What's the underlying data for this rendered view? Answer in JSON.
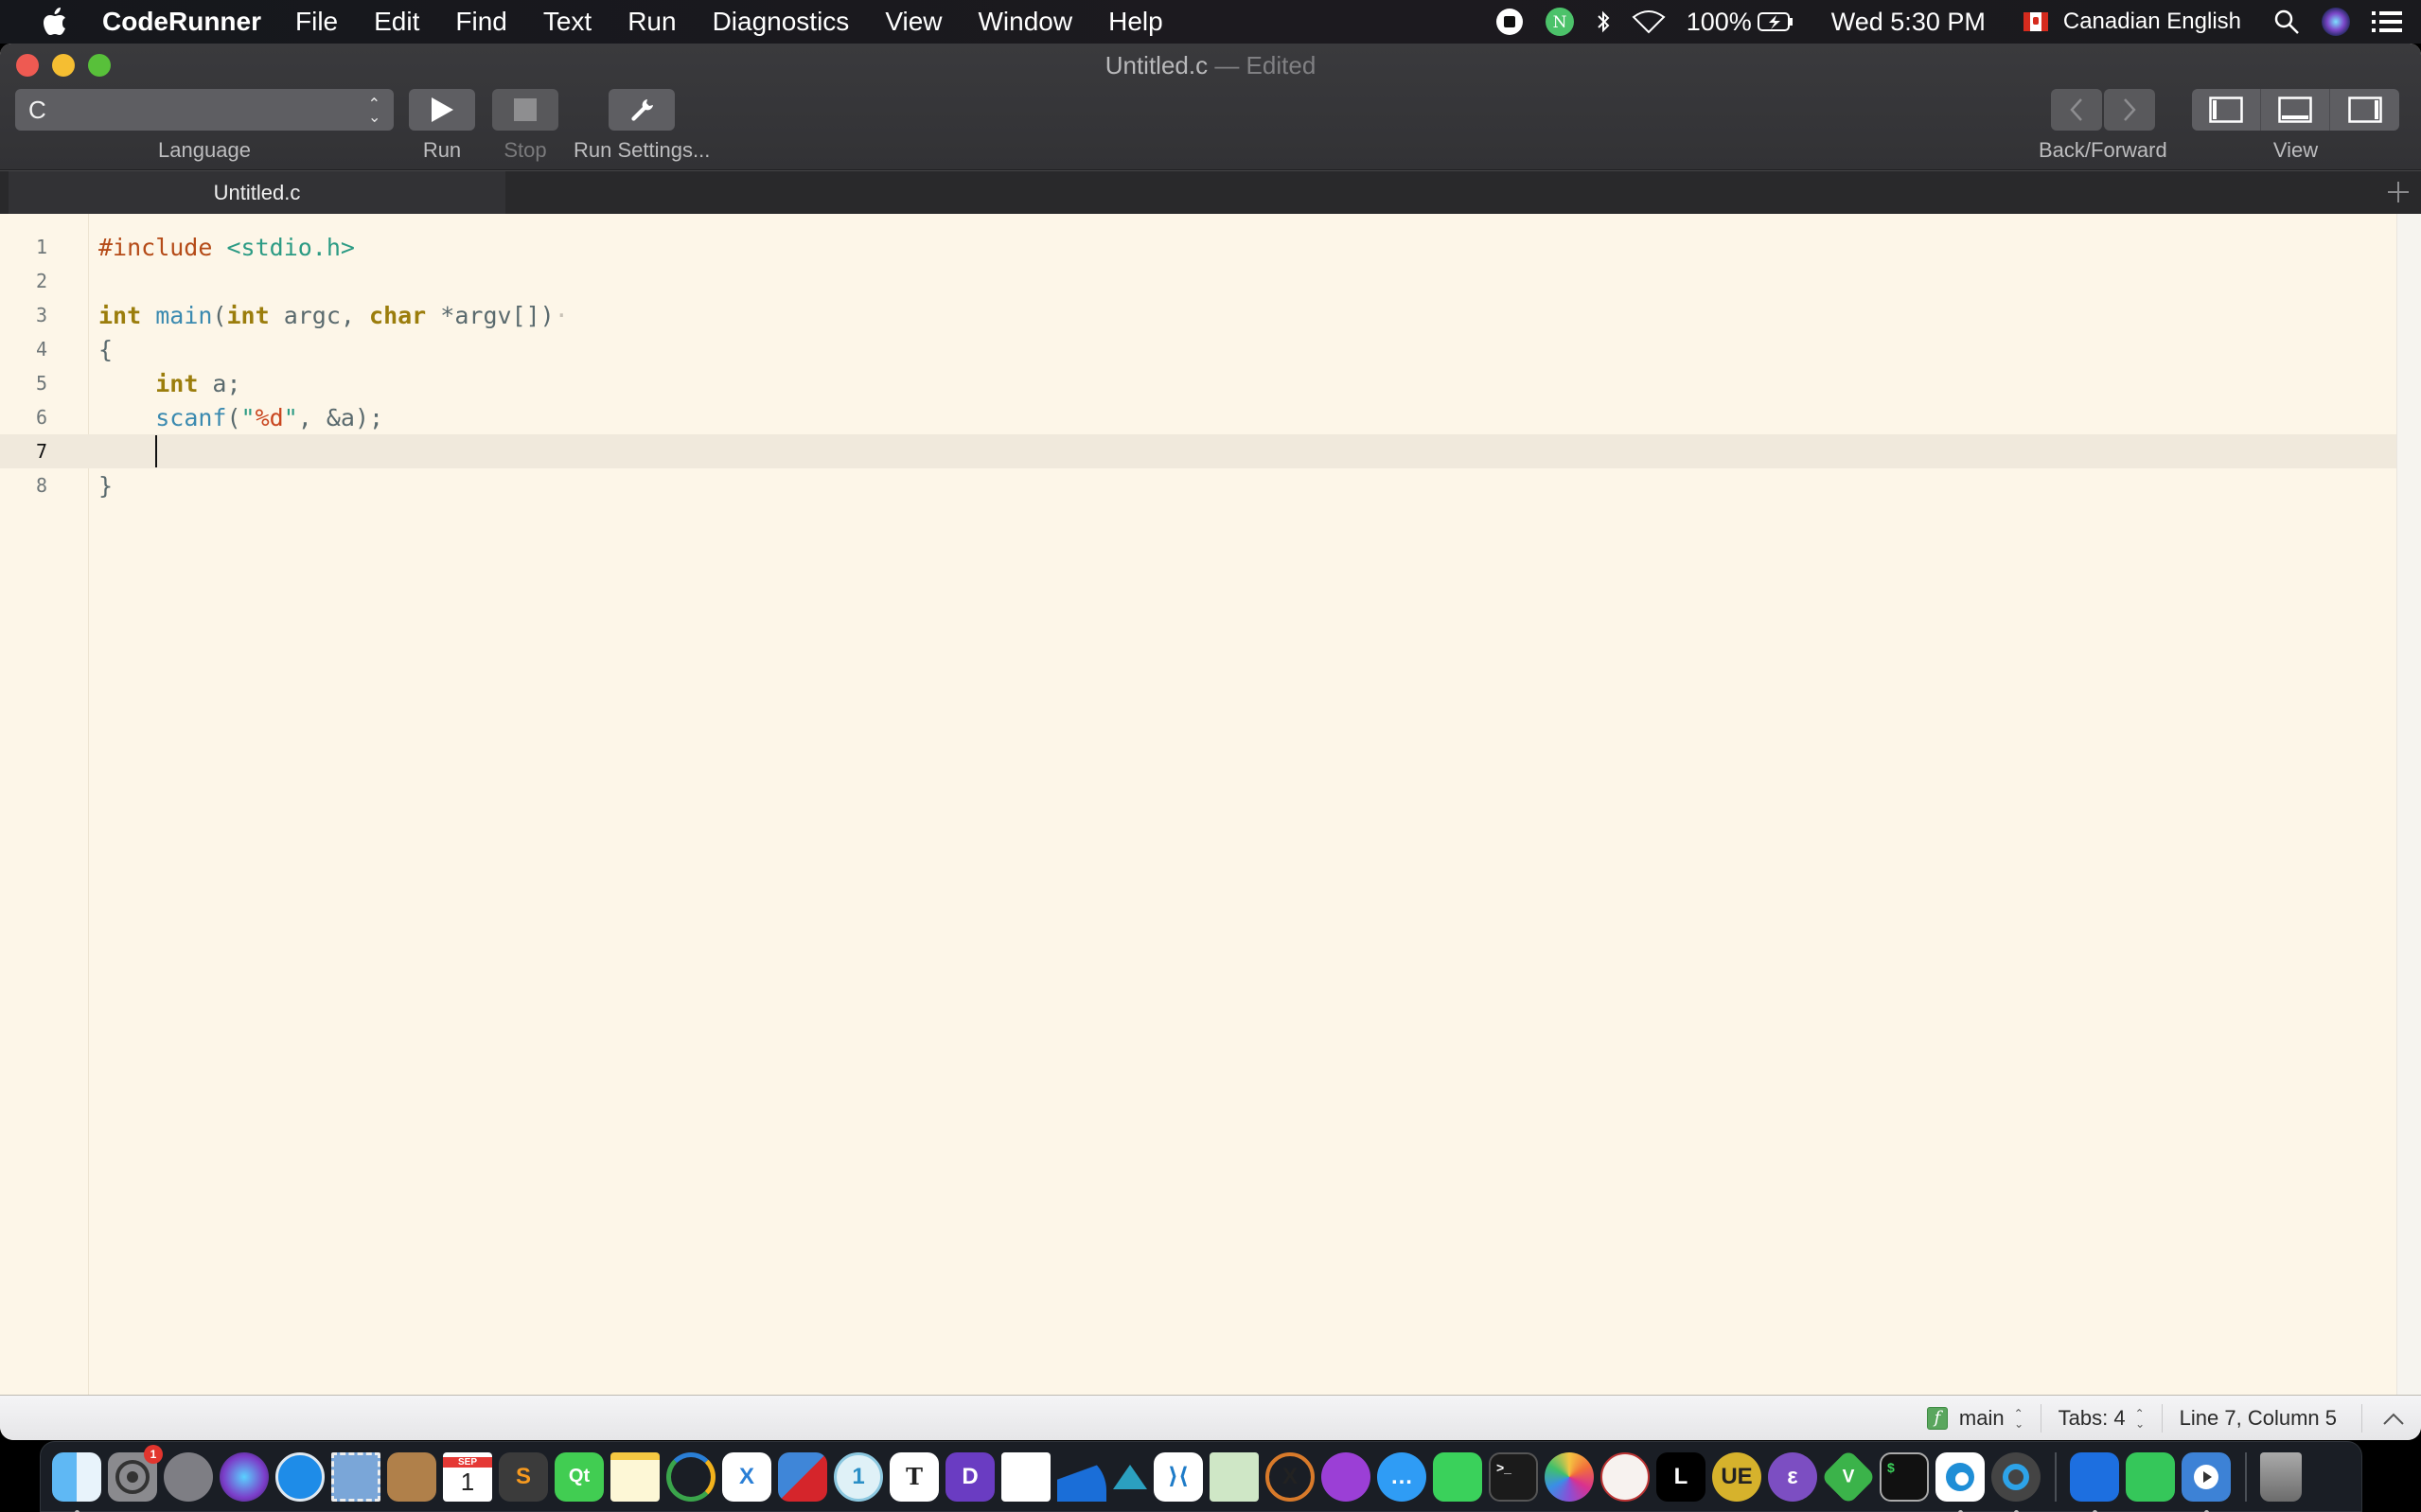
{
  "menubar": {
    "app_name": "CodeRunner",
    "menus": [
      "File",
      "Edit",
      "Find",
      "Text",
      "Run",
      "Diagnostics",
      "View",
      "Window",
      "Help"
    ],
    "status": {
      "battery": "100%",
      "clock": "Wed 5:30 PM",
      "input_source": "Canadian English"
    }
  },
  "window": {
    "title": "Untitled.c",
    "title_suffix": "— Edited"
  },
  "toolbar": {
    "language_value": "C",
    "language_label": "Language",
    "run_label": "Run",
    "stop_label": "Stop",
    "run_settings_label": "Run Settings...",
    "back_forward_label": "Back/Forward",
    "view_label": "View"
  },
  "tabs": [
    {
      "label": "Untitled.c",
      "active": true
    }
  ],
  "editor": {
    "current_line": 7,
    "lines": [
      {
        "n": "1",
        "code": "#include <stdio.h>"
      },
      {
        "n": "2",
        "code": ""
      },
      {
        "n": "3",
        "code": "int main(int argc, char *argv[])"
      },
      {
        "n": "4",
        "code": "{"
      },
      {
        "n": "5",
        "code": "    int a;"
      },
      {
        "n": "6",
        "code": "    scanf(\"%d\", &a);"
      },
      {
        "n": "7",
        "code": "    "
      },
      {
        "n": "8",
        "code": "}"
      }
    ]
  },
  "statusbar": {
    "function_badge": "f",
    "function_name": "main",
    "tabs": "Tabs: 4",
    "position": "Line 7, Column 5"
  },
  "dock": {
    "apps": [
      {
        "name": "Finder",
        "running": true
      },
      {
        "name": "System Preferences",
        "badge": "1"
      },
      {
        "name": "Launchpad"
      },
      {
        "name": "Siri"
      },
      {
        "name": "Safari"
      },
      {
        "name": "Mail"
      },
      {
        "name": "Contacts"
      },
      {
        "name": "Calendar",
        "month": "SEP",
        "day": "1"
      },
      {
        "name": "Sublime Text"
      },
      {
        "name": "Qt Creator",
        "glyph": "Qt"
      },
      {
        "name": "Notes"
      },
      {
        "name": "Anaconda Navigator"
      },
      {
        "name": "Xmind"
      },
      {
        "name": "Parallels"
      },
      {
        "name": "1Password",
        "glyph": "1"
      },
      {
        "name": "Typora",
        "glyph": "T"
      },
      {
        "name": "Dash",
        "glyph": "D"
      },
      {
        "name": "Reminders"
      },
      {
        "name": "Wireshark"
      },
      {
        "name": "Affinity"
      },
      {
        "name": "Visual Studio Code"
      },
      {
        "name": "Maps"
      },
      {
        "name": "X11"
      },
      {
        "name": "Podcasts"
      },
      {
        "name": "Messages"
      },
      {
        "name": "FaceTime"
      },
      {
        "name": "Terminal",
        "glyph": ">_"
      },
      {
        "name": "Photos"
      },
      {
        "name": "Racket"
      },
      {
        "name": "Lingo",
        "glyph": "L"
      },
      {
        "name": "UltraEdit",
        "glyph": "UE"
      },
      {
        "name": "Emacs",
        "glyph": "ε"
      },
      {
        "name": "MacVim",
        "glyph": "V"
      },
      {
        "name": "iTerm",
        "glyph": "$"
      },
      {
        "name": "Microsoft Edge",
        "running": true
      },
      {
        "name": "QuickTime Player",
        "running": true
      },
      {
        "name": "Xcode",
        "running": true,
        "after_separator": true
      },
      {
        "name": "Archive Utility"
      },
      {
        "name": "CodeRunner",
        "running": true
      },
      {
        "name": "Trash",
        "after_separator": true
      }
    ]
  }
}
